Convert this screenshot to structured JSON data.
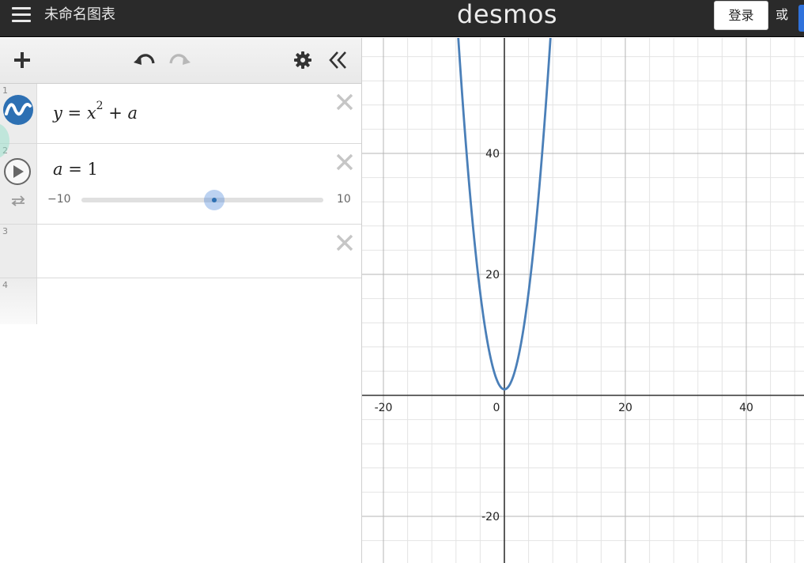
{
  "header": {
    "graph_title": "未命名图表",
    "logo": "desmos",
    "login_label": "登录",
    "or_label": "或"
  },
  "expressions": [
    {
      "index": "1",
      "latex_parts": {
        "lhs": "y",
        "eq": " = ",
        "base": "x",
        "exp": "2",
        "op": " + ",
        "rhs": "a"
      },
      "color": "#2d70b3"
    },
    {
      "index": "2",
      "variable": "a",
      "eq": " = ",
      "value": "1",
      "slider": {
        "min_label": "−10",
        "max_label": "10",
        "min": -10,
        "max": 10,
        "value": 1
      }
    },
    {
      "index": "3"
    },
    {
      "index": "4"
    }
  ],
  "graph": {
    "x_ticks": [
      "-20",
      "0",
      "20",
      "40"
    ],
    "y_ticks": [
      "40",
      "20",
      "-20"
    ],
    "curve_color": "#4a7fb8",
    "axis_color": "#333333",
    "major_grid_color": "#b5b5b5",
    "minor_grid_color": "#e4e4e4"
  },
  "icons": {
    "add": "plus-icon",
    "undo": "undo-icon",
    "redo": "redo-icon",
    "settings": "gear-icon",
    "collapse": "double-chevron-left-icon",
    "close": "close-icon",
    "play": "play-icon",
    "loop": "loop-icon",
    "menu": "hamburger-icon"
  }
}
